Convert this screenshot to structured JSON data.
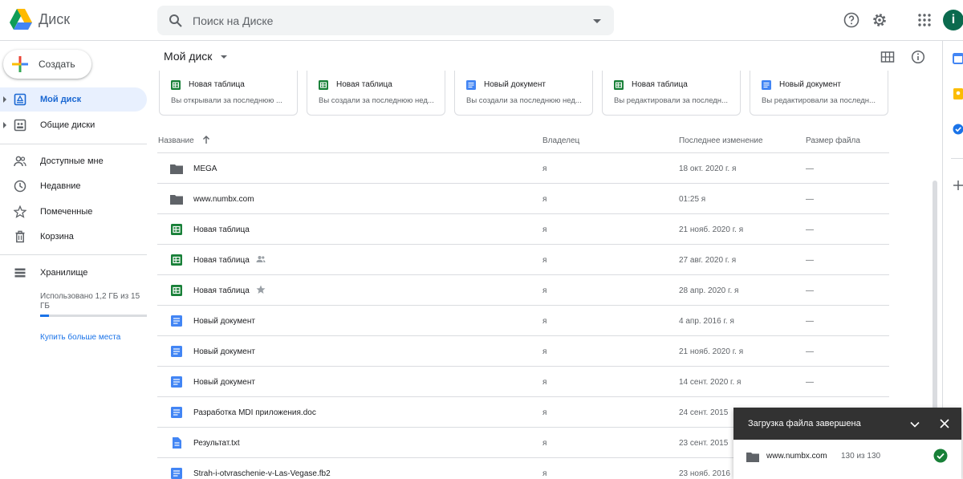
{
  "header": {
    "app_name": "Диск",
    "search_placeholder": "Поиск на Диске",
    "avatar_letter": "i"
  },
  "sidebar": {
    "create_label": "Создать",
    "items": [
      {
        "label": "Мой диск",
        "icon": "my-drive-icon",
        "active": true,
        "expandable": true
      },
      {
        "label": "Общие диски",
        "icon": "shared-drives-icon",
        "active": false,
        "expandable": true
      },
      {
        "label": "Доступные мне",
        "icon": "shared-with-me-icon",
        "active": false,
        "expandable": false
      },
      {
        "label": "Недавние",
        "icon": "clock-icon",
        "active": false,
        "expandable": false
      },
      {
        "label": "Помеченные",
        "icon": "star-icon",
        "active": false,
        "expandable": false
      },
      {
        "label": "Корзина",
        "icon": "trash-icon",
        "active": false,
        "expandable": false
      }
    ],
    "storage": {
      "label": "Хранилище",
      "usage_text": "Использовано 1,2 ГБ из 15 ГБ",
      "used_fraction": 0.08,
      "buy_label": "Купить больше места"
    }
  },
  "main": {
    "title": "Мой диск",
    "quick_access": [
      {
        "type": "sheet",
        "title": "Новая таблица",
        "subtitle": "Вы открывали за последнюю ..."
      },
      {
        "type": "sheet",
        "title": "Новая таблица",
        "subtitle": "Вы создали за последнюю нед..."
      },
      {
        "type": "doc",
        "title": "Новый документ",
        "subtitle": "Вы создали за последнюю нед..."
      },
      {
        "type": "sheet",
        "title": "Новая таблица",
        "subtitle": "Вы редактировали за последн..."
      },
      {
        "type": "doc",
        "title": "Новый документ",
        "subtitle": "Вы редактировали за последн..."
      }
    ],
    "columns": {
      "name": "Название",
      "owner": "Владелец",
      "modified": "Последнее изменение",
      "size": "Размер файла"
    },
    "files": [
      {
        "name": "MEGA",
        "type": "folder",
        "owner": "я",
        "modified": "18 окт. 2020 г. я",
        "size": "—"
      },
      {
        "name": "www.numbx.com",
        "type": "folder",
        "owner": "я",
        "modified": "01:25 я",
        "size": "—"
      },
      {
        "name": "Новая таблица",
        "type": "sheet",
        "owner": "я",
        "modified": "21 нояб. 2020 г. я",
        "size": "—"
      },
      {
        "name": "Новая таблица",
        "type": "sheet",
        "tag": "shared",
        "owner": "я",
        "modified": "27 авг. 2020 г. я",
        "size": "—"
      },
      {
        "name": "Новая таблица",
        "type": "sheet",
        "tag": "starred",
        "owner": "я",
        "modified": "28 апр. 2020 г. я",
        "size": "—"
      },
      {
        "name": "Новый документ",
        "type": "doc",
        "owner": "я",
        "modified": "4 апр. 2016 г. я",
        "size": "—"
      },
      {
        "name": "Новый документ",
        "type": "doc",
        "owner": "я",
        "modified": "21 нояб. 2020 г. я",
        "size": "—"
      },
      {
        "name": "Новый документ",
        "type": "doc",
        "owner": "я",
        "modified": "14 сент. 2020 г. я",
        "size": "—"
      },
      {
        "name": "Разработка MDI приложения.doc",
        "type": "doc",
        "owner": "я",
        "modified": "24 сент. 2015",
        "size": ""
      },
      {
        "name": "Результат.txt",
        "type": "txt",
        "owner": "я",
        "modified": "23 сент. 2015",
        "size": ""
      },
      {
        "name": "Strah-i-otvraschenie-v-Las-Vegase.fb2",
        "type": "doc",
        "owner": "я",
        "modified": "23 нояб. 2016",
        "size": ""
      }
    ]
  },
  "upload_toast": {
    "title": "Загрузка файла завершена",
    "item_name": "www.numbx.com",
    "item_count": "130 из 130"
  },
  "colors": {
    "accent": "#1a73e8",
    "sheet_green": "#188038",
    "doc_blue": "#4285f4",
    "folder_gray": "#5f6368",
    "success_green": "#188038"
  }
}
